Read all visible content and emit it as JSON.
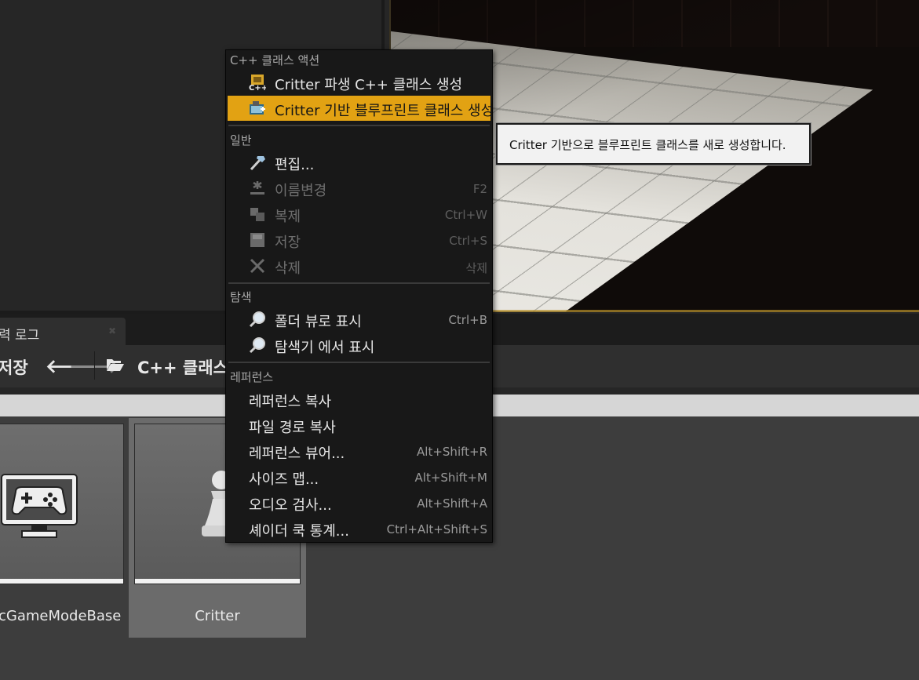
{
  "output_log_tab": {
    "label": "력 로그",
    "close_icon": "close-icon"
  },
  "toolbar": {
    "save_label": "저장",
    "back_icon": "arrow-left-icon",
    "forward_icon": "arrow-right-icon",
    "folder_icon": "folder-open-icon",
    "path": "C++ 클래스"
  },
  "assets": [
    {
      "label": "cGameModeBase",
      "icon": "gamepad-monitor-icon",
      "selected": false
    },
    {
      "label": "Critter",
      "icon": "pawn-icon",
      "selected": true
    }
  ],
  "context_menu": {
    "sections": [
      {
        "heading": "C++ 클래스 액션",
        "items": [
          {
            "label": "Critter 파생 C++ 클래스 생성",
            "icon": "cpp-class-icon",
            "shortcut": "",
            "enabled": true,
            "highlighted": false
          },
          {
            "label": "Critter 기반 블루프린트 클래스 생성",
            "icon": "blueprint-class-icon",
            "shortcut": "",
            "enabled": true,
            "highlighted": true
          }
        ]
      },
      {
        "heading": "일반",
        "items": [
          {
            "label": "편집...",
            "icon": "hammer-icon",
            "shortcut": "",
            "enabled": true,
            "highlighted": false
          },
          {
            "label": "이름변경",
            "icon": "rename-icon",
            "shortcut": "F2",
            "enabled": false,
            "highlighted": false
          },
          {
            "label": "복제",
            "icon": "duplicate-icon",
            "shortcut": "Ctrl+W",
            "enabled": false,
            "highlighted": false
          },
          {
            "label": "저장",
            "icon": "save-icon",
            "shortcut": "Ctrl+S",
            "enabled": false,
            "highlighted": false
          },
          {
            "label": "삭제",
            "icon": "delete-icon",
            "shortcut": "삭제",
            "enabled": false,
            "highlighted": false
          }
        ]
      },
      {
        "heading": "탐색",
        "items": [
          {
            "label": "폴더 뷰로 표시",
            "icon": "magnifier-icon",
            "shortcut": "Ctrl+B",
            "enabled": true,
            "highlighted": false
          },
          {
            "label": "탐색기 에서 표시",
            "icon": "magnifier-icon",
            "shortcut": "",
            "enabled": true,
            "highlighted": false
          }
        ]
      },
      {
        "heading": "레퍼런스",
        "items": [
          {
            "label": "레퍼런스 복사",
            "icon": "",
            "shortcut": "",
            "enabled": true,
            "highlighted": false
          },
          {
            "label": "파일 경로 복사",
            "icon": "",
            "shortcut": "",
            "enabled": true,
            "highlighted": false
          },
          {
            "label": "레퍼런스 뷰어...",
            "icon": "",
            "shortcut": "Alt+Shift+R",
            "enabled": true,
            "highlighted": false
          },
          {
            "label": "사이즈 맵...",
            "icon": "",
            "shortcut": "Alt+Shift+M",
            "enabled": true,
            "highlighted": false
          },
          {
            "label": "오디오 검사...",
            "icon": "",
            "shortcut": "Alt+Shift+A",
            "enabled": true,
            "highlighted": false
          },
          {
            "label": "셰이더 쿡 통계...",
            "icon": "",
            "shortcut": "Ctrl+Alt+Shift+S",
            "enabled": true,
            "highlighted": false
          }
        ]
      }
    ]
  },
  "tooltip": {
    "text": "Critter 기반으로 블루프린트 클래스를 새로 생성합니다."
  },
  "colors": {
    "highlight": "#e2a213",
    "menu_bg": "#181818",
    "panel_bg": "#262626",
    "content_bg": "#3d3d3d"
  }
}
